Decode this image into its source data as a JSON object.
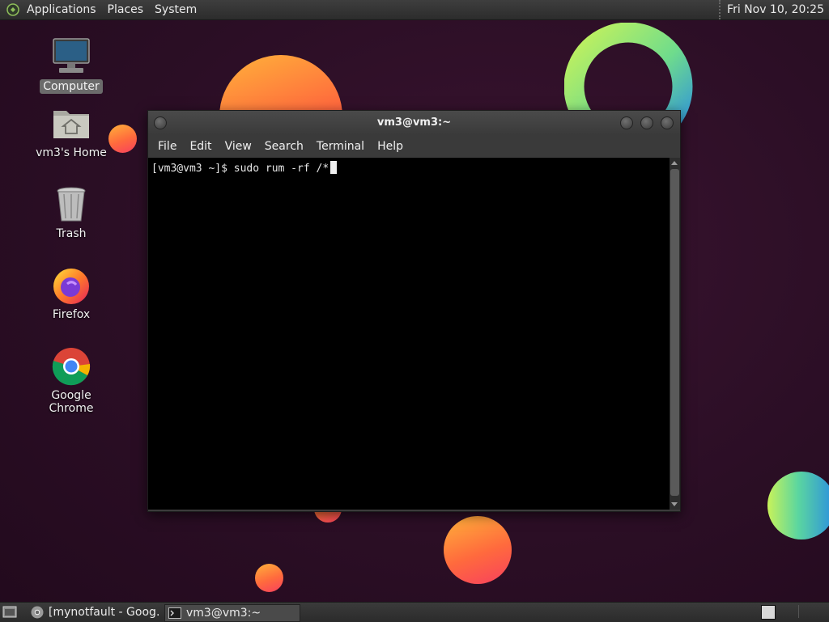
{
  "top_panel": {
    "menus": [
      "Applications",
      "Places",
      "System"
    ],
    "clock": "Fri Nov 10, 20:25"
  },
  "desktop": {
    "icons": [
      {
        "label": "Computer",
        "icon": "computer-icon"
      },
      {
        "label": "vm3's Home",
        "icon": "home-folder-icon"
      },
      {
        "label": "Trash",
        "icon": "trash-icon"
      },
      {
        "label": "Firefox",
        "icon": "firefox-icon"
      },
      {
        "label": "Google Chrome",
        "icon": "chrome-icon"
      }
    ]
  },
  "terminal": {
    "title": "vm3@vm3:~",
    "menu": [
      "File",
      "Edit",
      "View",
      "Search",
      "Terminal",
      "Help"
    ],
    "prompt": "[vm3@vm3 ~]$ sudo rum -rf /*"
  },
  "taskbar": {
    "tasks": [
      {
        "label": "[mynotfault - Goog…",
        "icon": "chrome-icon"
      },
      {
        "label": "vm3@vm3:~",
        "icon": "terminal-icon"
      }
    ]
  },
  "colors": {
    "wallpaper": "#2b0e25",
    "panel": "#333333",
    "terminal_bg": "#000000",
    "accent_orange": "#ff6a3d"
  }
}
